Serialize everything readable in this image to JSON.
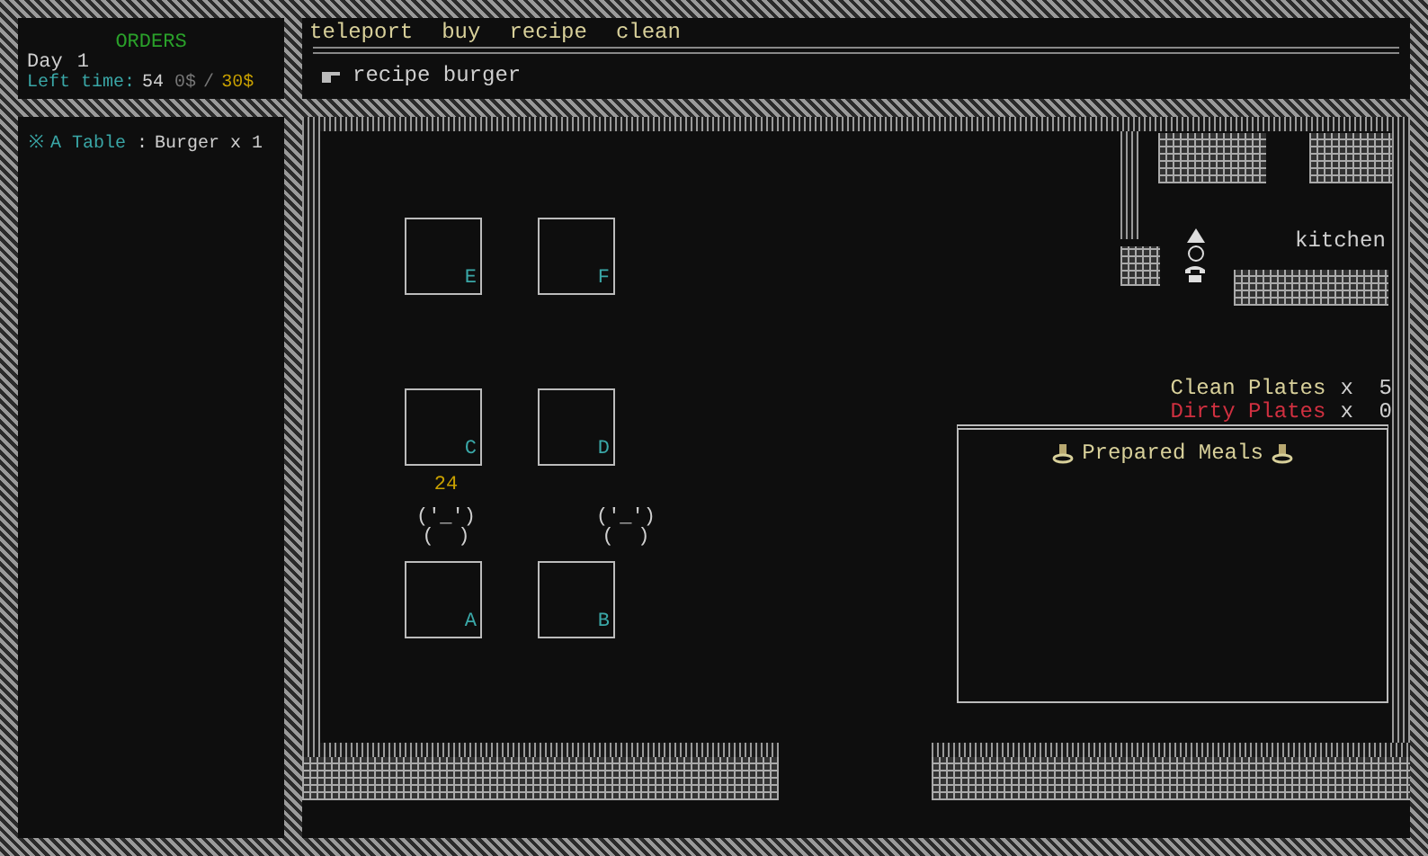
{
  "orders_panel": {
    "title": "ORDERS",
    "day_label": "Day",
    "day": "1",
    "time_label": "Left time:",
    "time": "54",
    "money": "0$",
    "separator": "/",
    "goal": "30$"
  },
  "orders": [
    {
      "marker": "※",
      "table": "A Table",
      "separator": ":",
      "dish": "Burger",
      "quantity": "x 1"
    }
  ],
  "menu": [
    {
      "label": "teleport"
    },
    {
      "label": "buy"
    },
    {
      "label": "recipe"
    },
    {
      "label": "clean"
    }
  ],
  "command": {
    "text": "recipe burger"
  },
  "tables": [
    {
      "label": "E"
    },
    {
      "label": "F"
    },
    {
      "label": "C"
    },
    {
      "label": "D"
    },
    {
      "label": "A"
    },
    {
      "label": "B"
    }
  ],
  "customers": [
    {
      "timer": "24",
      "face": "('_')",
      "body": "(  )"
    },
    {
      "face": "('_')",
      "body": "(  )"
    }
  ],
  "kitchen": {
    "label": "kitchen"
  },
  "plates": [
    {
      "kind": "clean",
      "label": "Clean Plates",
      "count": "x  5"
    },
    {
      "kind": "dirty",
      "label": "Dirty Plates",
      "count": "x  0"
    }
  ],
  "prepared_meals": {
    "title": "Prepared Meals"
  }
}
